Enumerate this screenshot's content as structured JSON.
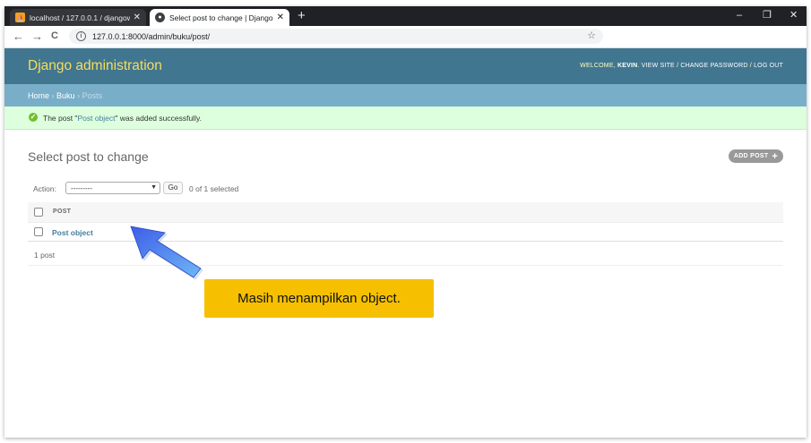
{
  "browser": {
    "tabs": [
      {
        "title": "localhost / 127.0.0.1 / djangowe",
        "close": "✕"
      },
      {
        "title": "Select post to change | Django s",
        "close": "✕"
      }
    ],
    "newtab": "+",
    "window_controls": {
      "minimize": "–",
      "restore": "❐",
      "close": "✕"
    },
    "nav": {
      "back": "←",
      "forward": "→",
      "reload": "C"
    },
    "url": "127.0.0.1:8000/admin/buku/post/",
    "info_glyph": "i",
    "star": "☆"
  },
  "admin": {
    "branding": "Django administration",
    "usertools": {
      "welcome": "WELCOME,",
      "user": "KEVIN",
      "view_site": "VIEW SITE",
      "change_password": "CHANGE PASSWORD",
      "log_out": "LOG OUT",
      "sep": "/"
    },
    "breadcrumbs": {
      "home": "Home",
      "app": "Buku",
      "current": "Posts",
      "sep": "›"
    },
    "message": {
      "prefix": "The post \"",
      "link": "Post object",
      "suffix": "\" was added successfully."
    },
    "page_title": "Select post to change",
    "add_button": "ADD POST",
    "actions": {
      "label": "Action:",
      "selected": "---------",
      "go": "Go",
      "counter": "0 of 1 selected"
    },
    "table": {
      "header": "POST",
      "rows": [
        {
          "label": "Post object"
        }
      ]
    },
    "paginator": "1 post"
  },
  "annotation": {
    "callout": "Masih menampilkan object.",
    "arrow_color": "#5b7cf0"
  },
  "colors": {
    "header_bg": "#417690",
    "branding": "#f5dd5d",
    "breadcrumbs_bg": "#79aec8",
    "success_bg": "#ddffdd",
    "link": "#447e9b",
    "callout_bg": "#f6c000"
  }
}
